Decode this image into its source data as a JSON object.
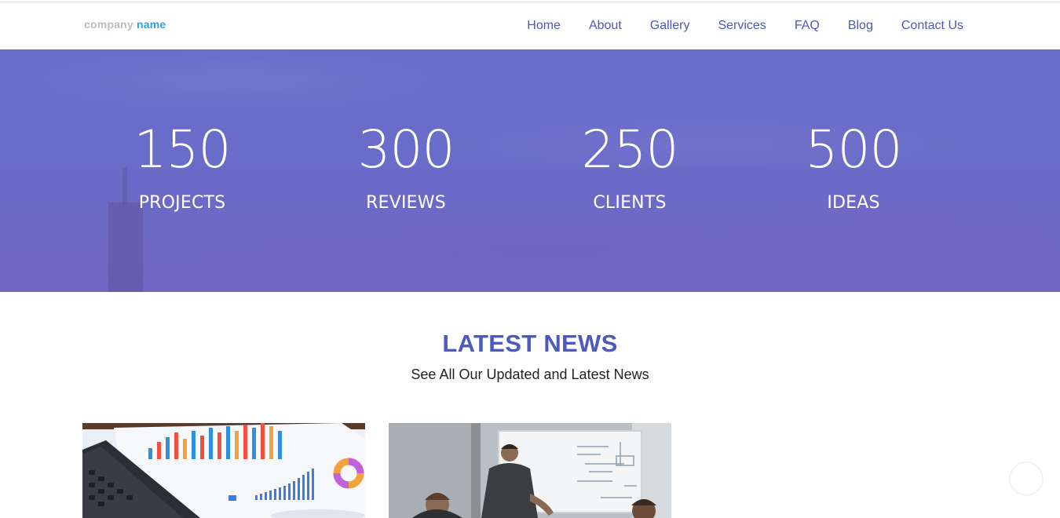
{
  "header": {
    "logo_part1": "company",
    "logo_part2": "name",
    "nav": [
      {
        "label": "Home"
      },
      {
        "label": "About"
      },
      {
        "label": "Gallery"
      },
      {
        "label": "Services"
      },
      {
        "label": "FAQ"
      },
      {
        "label": "Blog"
      },
      {
        "label": "Contact Us"
      }
    ]
  },
  "stats": [
    {
      "number": "150",
      "label": "PROJECTS"
    },
    {
      "number": "300",
      "label": "REVIEWS"
    },
    {
      "number": "250",
      "label": "CLIENTS"
    },
    {
      "number": "500",
      "label": "IDEAS"
    }
  ],
  "news": {
    "title": "LATEST NEWS",
    "subtitle": "See All Our Updated and Latest News"
  },
  "colors": {
    "brand_blue": "#29a3e6",
    "nav_link": "#4b59b7",
    "banner": "#6a6ccb",
    "news_title": "#4b59c0"
  }
}
